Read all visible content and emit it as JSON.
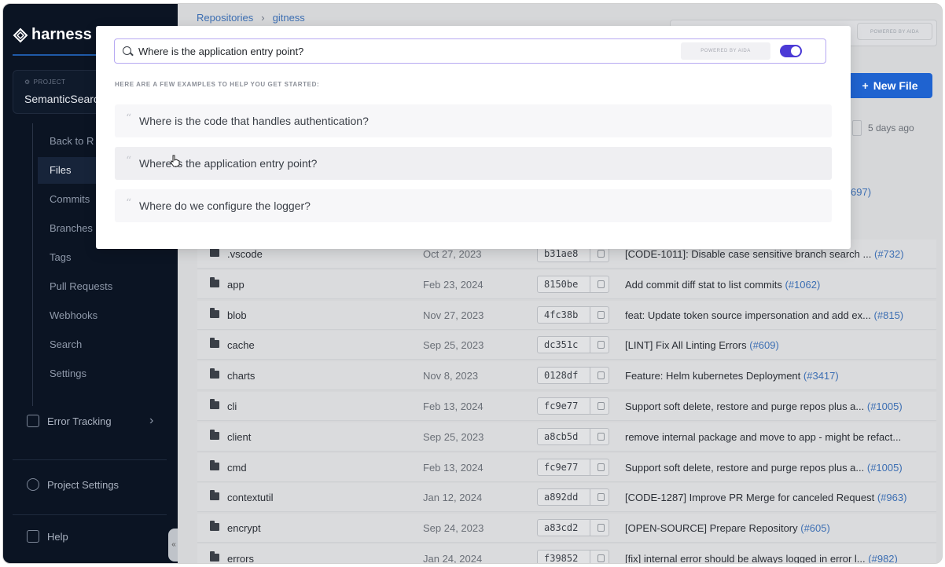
{
  "sidebar": {
    "brand": "harness",
    "project_label": "PROJECT",
    "project_name": "SemanticSearch",
    "nav": [
      "Back to R",
      "Files",
      "Commits",
      "Branches",
      "Tags",
      "Pull Requests",
      "Webhooks",
      "Search",
      "Settings"
    ],
    "active_nav": "Files",
    "error_tracking": "Error Tracking",
    "project_settings": "Project Settings",
    "help": "Help"
  },
  "main": {
    "breadcrumb": [
      "Repositories",
      "gitness"
    ],
    "top_badge": "POWERED BY AIDA",
    "new_file_label": "New File",
    "last_updated": "5 days ago",
    "partial_pr": "697)",
    "rows": [
      {
        "name": ".vscode",
        "date": "Oct 27, 2023",
        "sha": "b31ae8",
        "message": "[CODE-1011]: Disable case sensitive branch search ...",
        "pr": "(#732)"
      },
      {
        "name": "app",
        "date": "Feb 23, 2024",
        "sha": "8150be",
        "message": "Add commit diff stat to list commits",
        "pr": "(#1062)"
      },
      {
        "name": "blob",
        "date": "Nov 27, 2023",
        "sha": "4fc38b",
        "message": "feat: Update token source impersonation and add ex...",
        "pr": "(#815)"
      },
      {
        "name": "cache",
        "date": "Sep 25, 2023",
        "sha": "dc351c",
        "message": "[LINT] Fix All Linting Errors",
        "pr": "(#609)"
      },
      {
        "name": "charts",
        "date": "Nov 8, 2023",
        "sha": "0128df",
        "message": "Feature: Helm kubernetes Deployment",
        "pr": "(#3417)"
      },
      {
        "name": "cli",
        "date": "Feb 13, 2024",
        "sha": "fc9e77",
        "message": "Support soft delete, restore and purge repos plus a...",
        "pr": "(#1005)"
      },
      {
        "name": "client",
        "date": "Sep 25, 2023",
        "sha": "a8cb5d",
        "message": "remove internal package and move to app - might be refact...",
        "pr": ""
      },
      {
        "name": "cmd",
        "date": "Feb 13, 2024",
        "sha": "fc9e77",
        "message": "Support soft delete, restore and purge repos plus a...",
        "pr": "(#1005)"
      },
      {
        "name": "contextutil",
        "date": "Jan 12, 2024",
        "sha": "a892dd",
        "message": "[CODE-1287] Improve PR Merge for canceled Request",
        "pr": "(#963)"
      },
      {
        "name": "encrypt",
        "date": "Sep 24, 2023",
        "sha": "a83cd2",
        "message": "[OPEN-SOURCE] Prepare Repository",
        "pr": "(#605)"
      },
      {
        "name": "errors",
        "date": "Jan 24, 2024",
        "sha": "f39852",
        "message": "[fix] internal error should be always logged in error l...",
        "pr": "(#982)"
      }
    ]
  },
  "search_modal": {
    "query": "Where is the application entry point?",
    "badge": "POWERED BY AIDA",
    "toggle_on": true,
    "examples_heading": "HERE ARE A FEW EXAMPLES TO HELP YOU GET STARTED:",
    "examples": [
      "Where is the code that handles authentication?",
      "Where is the application entry point?",
      "Where do we configure the logger?"
    ]
  },
  "colors": {
    "sidebar_bg": "#0b1423",
    "accent_blue": "#1f63d0",
    "toggle_purple": "#4b3ad6",
    "link_blue": "#3d6fb3"
  }
}
